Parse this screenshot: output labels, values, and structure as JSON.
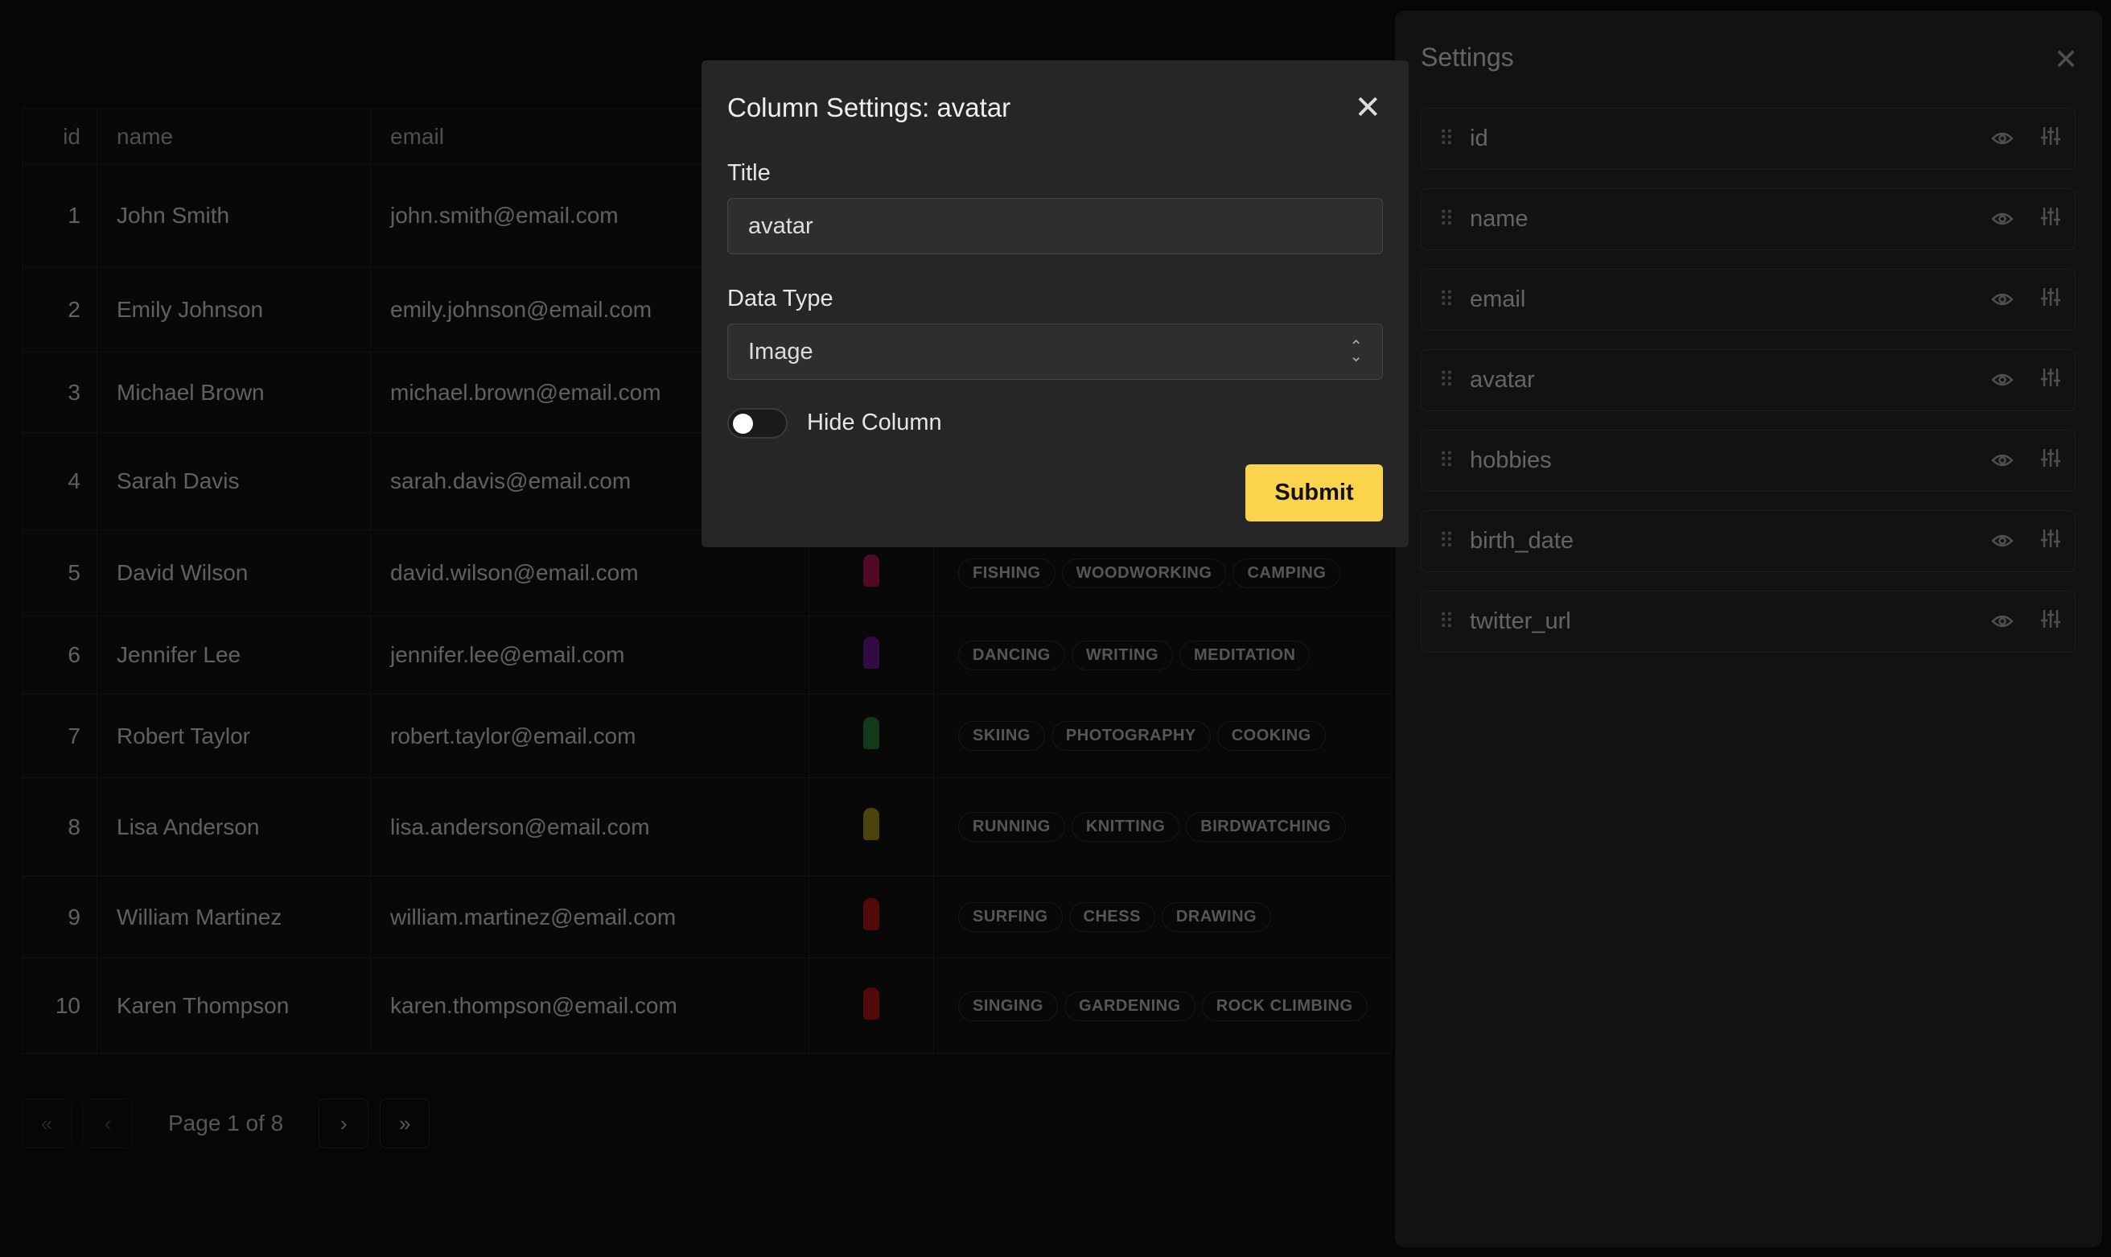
{
  "table": {
    "headers": [
      "id",
      "name",
      "email"
    ],
    "rows": [
      {
        "id": "1",
        "name": "John Smith",
        "email": "john.smith@email.com",
        "avatar_color": "",
        "hobbies": []
      },
      {
        "id": "2",
        "name": "Emily Johnson",
        "email": "emily.johnson@email.com",
        "avatar_color": "",
        "hobbies": []
      },
      {
        "id": "3",
        "name": "Michael Brown",
        "email": "michael.brown@email.com",
        "avatar_color": "",
        "hobbies": []
      },
      {
        "id": "4",
        "name": "Sarah Davis",
        "email": "sarah.davis@email.com",
        "avatar_color": "",
        "hobbies": []
      },
      {
        "id": "5",
        "name": "David Wilson",
        "email": "david.wilson@email.com",
        "avatar_color": "#c0185a",
        "hobbies": [
          "FISHING",
          "WOODWORKING",
          "CAMPING"
        ]
      },
      {
        "id": "6",
        "name": "Jennifer Lee",
        "email": "jennifer.lee@email.com",
        "avatar_color": "#7a1aa0",
        "hobbies": [
          "DANCING",
          "WRITING",
          "MEDITATION"
        ]
      },
      {
        "id": "7",
        "name": "Robert Taylor",
        "email": "robert.taylor@email.com",
        "avatar_color": "#2a8a3a",
        "hobbies": [
          "SKIING",
          "PHOTOGRAPHY",
          "COOKING"
        ]
      },
      {
        "id": "8",
        "name": "Lisa Anderson",
        "email": "lisa.anderson@email.com",
        "avatar_color": "#b8a020",
        "hobbies": [
          "RUNNING",
          "KNITTING",
          "BIRDWATCHING"
        ]
      },
      {
        "id": "9",
        "name": "William Martinez",
        "email": "william.martinez@email.com",
        "avatar_color": "#c01818",
        "hobbies": [
          "SURFING",
          "CHESS",
          "DRAWING"
        ]
      },
      {
        "id": "10",
        "name": "Karen Thompson",
        "email": "karen.thompson@email.com",
        "avatar_color": "#c01818",
        "hobbies": [
          "SINGING",
          "GARDENING",
          "ROCK CLIMBING"
        ]
      }
    ]
  },
  "pagination": {
    "label": "Page 1 of 8",
    "first": "«",
    "prev": "‹",
    "next": "›",
    "last": "»"
  },
  "settings": {
    "title": "Settings",
    "close": "✕",
    "columns": [
      "id",
      "name",
      "email",
      "avatar",
      "hobbies",
      "birth_date",
      "twitter_url"
    ],
    "icons": {
      "grip": "⠿",
      "visible": "👁",
      "adjust": "⚙"
    }
  },
  "modal": {
    "title": "Column Settings: avatar",
    "close": "✕",
    "title_label": "Title",
    "title_value": "avatar",
    "type_label": "Data Type",
    "type_value": "Image",
    "hide_label": "Hide Column",
    "hide_value": false,
    "submit": "Submit",
    "accent": "#fcd34d"
  }
}
